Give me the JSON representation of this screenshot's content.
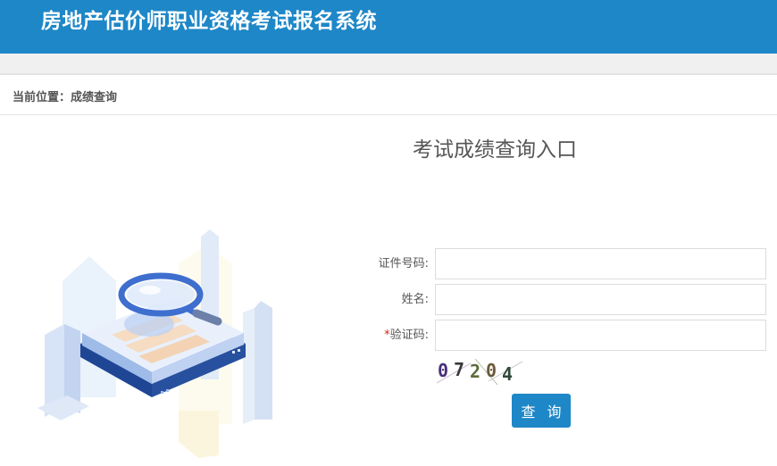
{
  "header": {
    "title": "房地产估价师职业资格考试报名系统"
  },
  "breadcrumb": {
    "text": "当前位置：成绩查询"
  },
  "form": {
    "title": "考试成绩查询入口",
    "fields": [
      {
        "label": "证件号码:",
        "value": "",
        "required": false
      },
      {
        "label": "姓名:",
        "value": "",
        "required": false
      },
      {
        "label": "验证码:",
        "value": "",
        "required": true,
        "required_mark": "*"
      }
    ],
    "captcha_text": "07204",
    "submit_label": "查 询"
  },
  "colors": {
    "header_bg": "#1e87c7",
    "button_bg": "#1e87c7",
    "required_mark": "#d9241b"
  }
}
